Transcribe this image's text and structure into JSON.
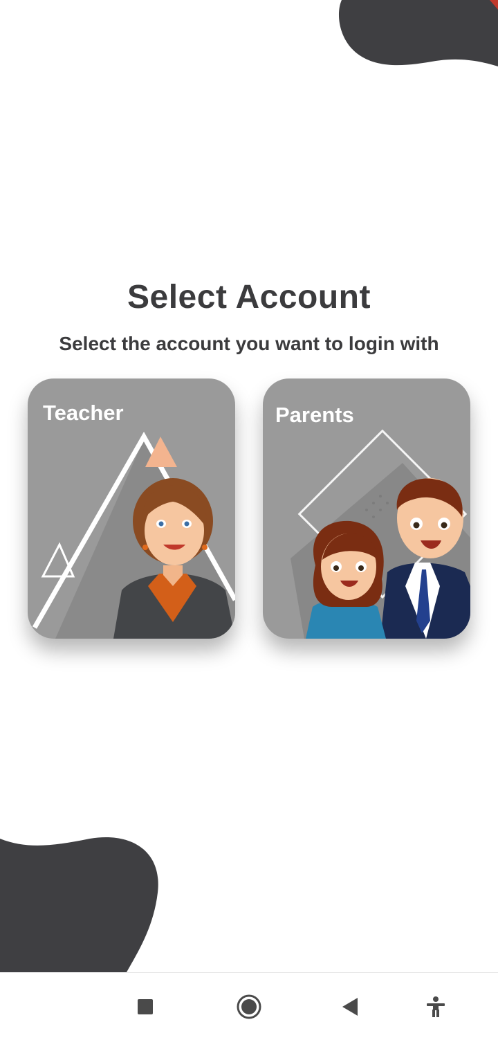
{
  "screen": {
    "title": "Select Account",
    "subtitle": "Select the account you want to login with"
  },
  "accounts": [
    {
      "label": "Teacher"
    },
    {
      "label": "Parents"
    }
  ],
  "colors": {
    "blob": "#3f3f42",
    "card_bg": "#9a9a9a",
    "text": "#3b3b3d"
  },
  "navbar": {
    "icons": [
      "recents-icon",
      "home-icon",
      "back-icon",
      "accessibility-icon"
    ]
  }
}
